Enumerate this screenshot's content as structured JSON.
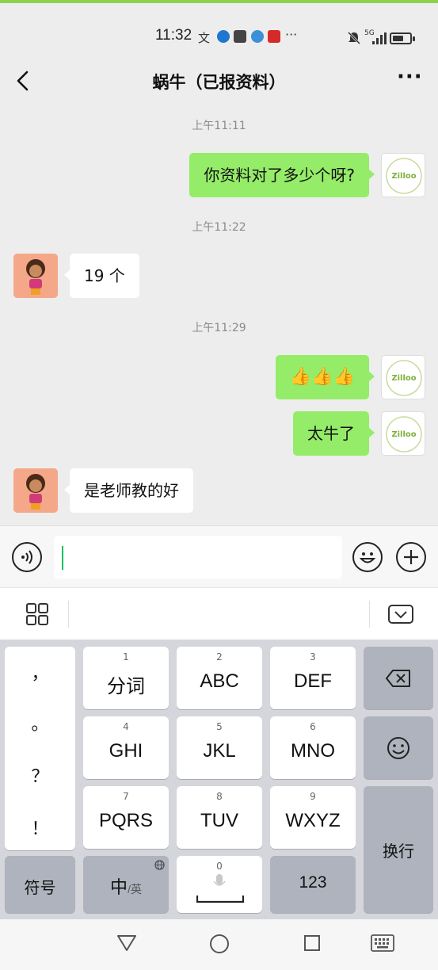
{
  "status_bar": {
    "time": "11:32",
    "overflow": "···",
    "network": "5G"
  },
  "header": {
    "title": "蜗牛（已报资料）",
    "more": "···"
  },
  "chat": {
    "messages": [
      {
        "timestamp": "上午11:11"
      },
      {
        "sender": "me",
        "text": "你资料对了多少个呀?"
      },
      {
        "timestamp": "上午11:22"
      },
      {
        "sender": "contact",
        "text": "19 个"
      },
      {
        "timestamp": "上午11:29"
      },
      {
        "sender": "me",
        "text": "👍👍👍"
      },
      {
        "sender": "me",
        "text": "太牛了"
      },
      {
        "sender": "contact",
        "text": "是老师教的好"
      }
    ],
    "my_avatar_text": "Zilloo"
  },
  "input": {
    "value": ""
  },
  "keyboard": {
    "punctuation": [
      "，",
      "。",
      "？",
      "！"
    ],
    "keys": [
      {
        "num": "1",
        "label": "分词"
      },
      {
        "num": "2",
        "label": "ABC"
      },
      {
        "num": "3",
        "label": "DEF"
      },
      {
        "num": "4",
        "label": "GHI"
      },
      {
        "num": "5",
        "label": "JKL"
      },
      {
        "num": "6",
        "label": "MNO"
      },
      {
        "num": "7",
        "label": "PQRS"
      },
      {
        "num": "8",
        "label": "TUV"
      },
      {
        "num": "9",
        "label": "WXYZ"
      }
    ],
    "symbols": "符号",
    "lang_main": "中",
    "lang_sub": "/英",
    "space_num": "0",
    "numbers": "123",
    "enter": "换行"
  },
  "colors": {
    "sent_bubble": "#95ec69",
    "received_bubble": "#ffffff",
    "accent": "#07c160",
    "background": "#ededed"
  },
  "icons": [
    "back-chevron-icon",
    "more-icon",
    "voice-icon",
    "emoji-icon",
    "plus-icon",
    "grid-icon",
    "collapse-keyboard-icon",
    "backspace-icon",
    "smiley-icon",
    "mic-icon",
    "globe-icon",
    "nav-back-icon",
    "nav-home-icon",
    "nav-recents-icon",
    "keyboard-icon"
  ]
}
